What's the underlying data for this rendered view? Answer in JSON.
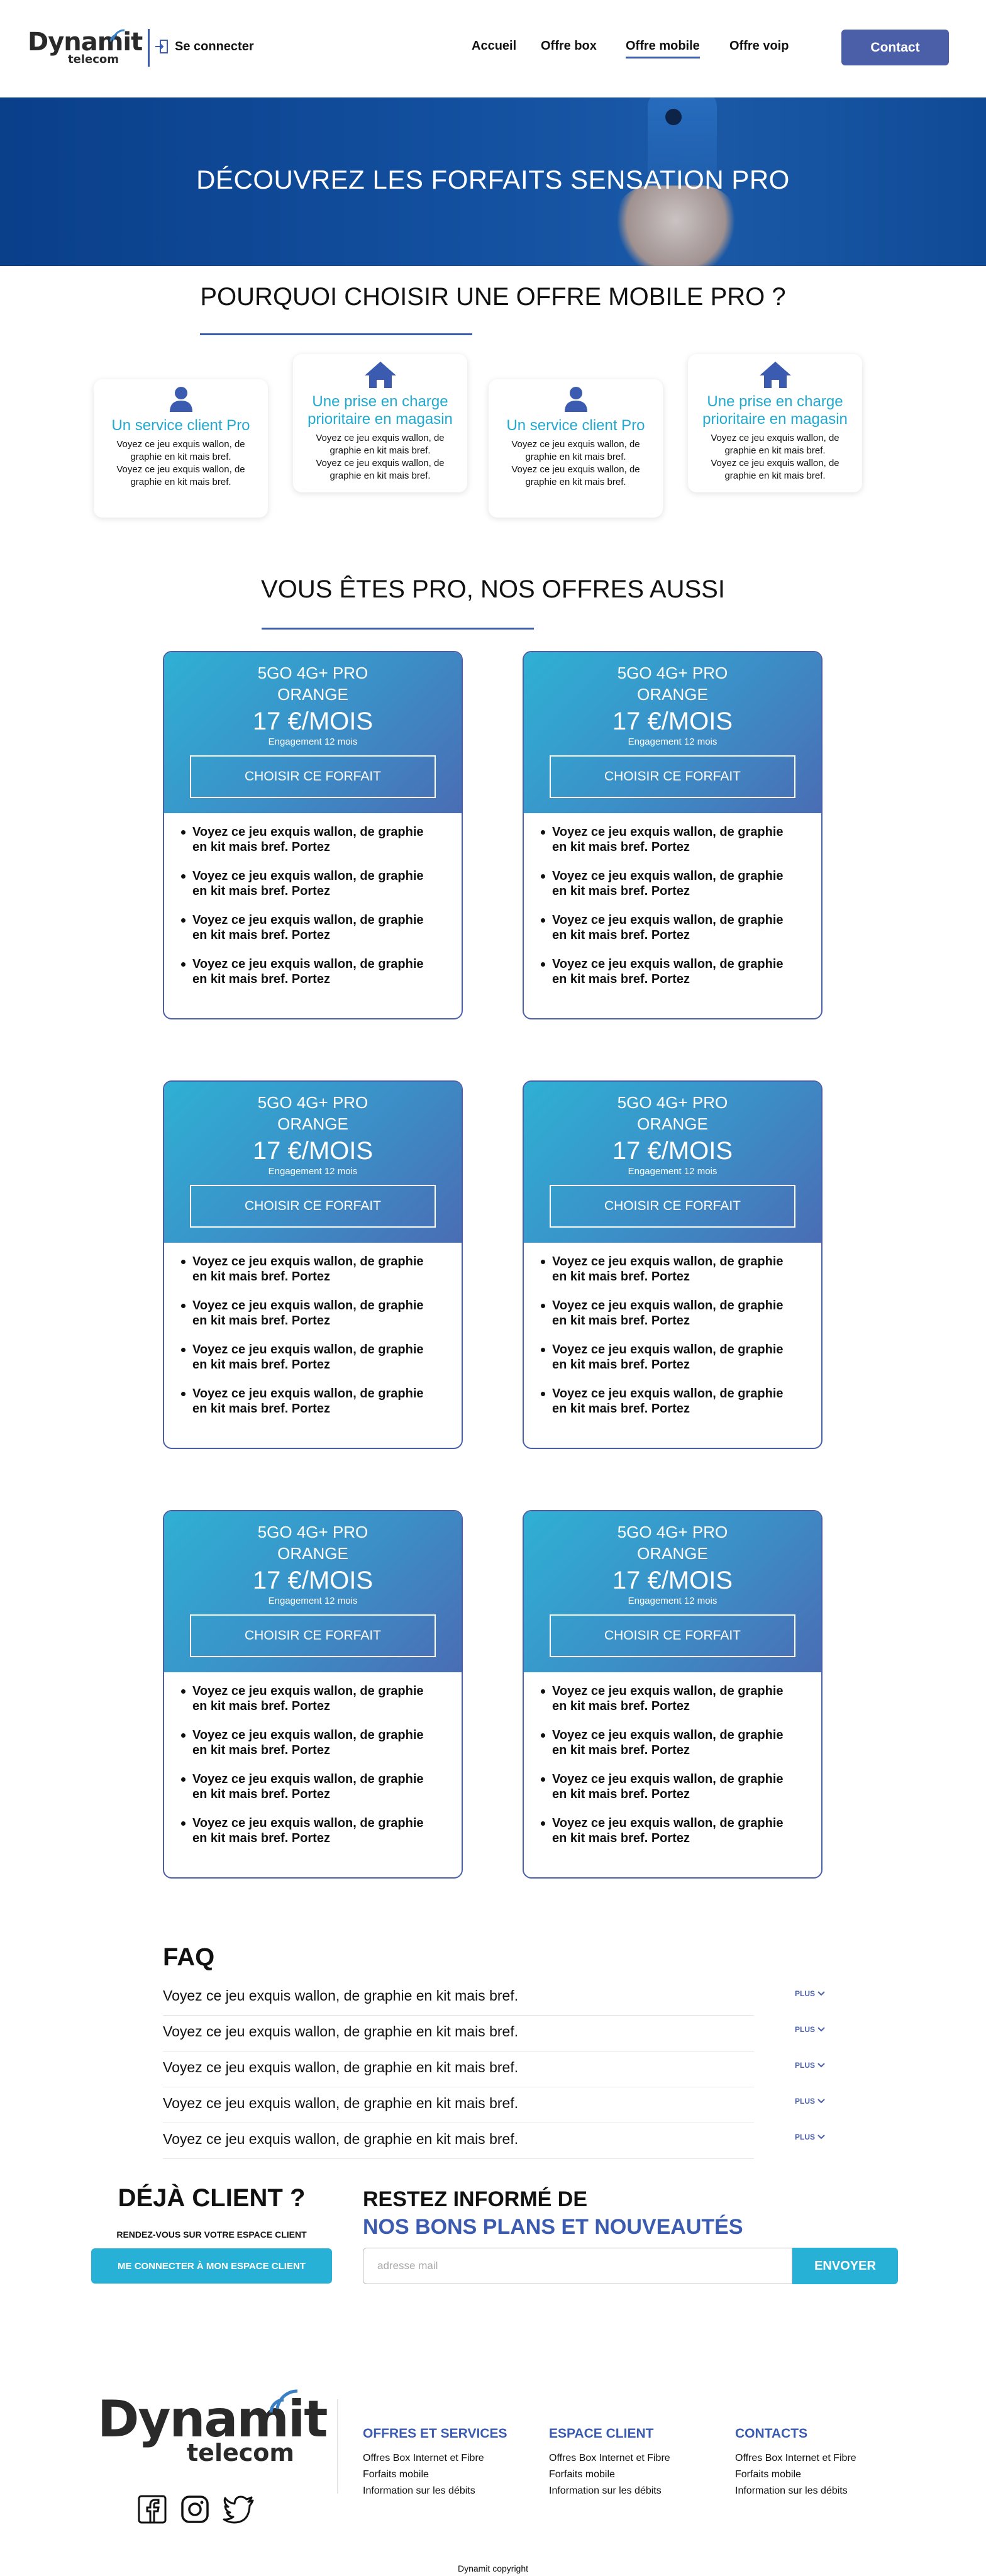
{
  "header": {
    "logo_text": "Dynamit",
    "logo_sub": "telecom",
    "login_label": "Se connecter",
    "nav": [
      {
        "label": "Accueil",
        "active": false
      },
      {
        "label": "Offre box",
        "active": false
      },
      {
        "label": "Offre mobile",
        "active": true
      },
      {
        "label": "Offre voip",
        "active": false
      }
    ],
    "contact_label": "Contact"
  },
  "hero": {
    "title": "DÉCOUVREZ LES FORFAITS SENSATION PRO"
  },
  "why": {
    "title": "POURQUOI CHOISIR UNE OFFRE MOBILE PRO ?",
    "features": [
      {
        "icon": "user-icon",
        "title": "Un service client Pro",
        "text1": "Voyez ce jeu exquis wallon, de graphie en kit mais bref.",
        "text2": "Voyez ce jeu exquis wallon, de graphie en kit mais bref."
      },
      {
        "icon": "home-icon",
        "title": "Une prise en charge prioritaire en magasin",
        "text1": "Voyez ce jeu exquis wallon, de graphie en kit mais bref.",
        "text2": "Voyez ce jeu exquis wallon, de graphie en kit mais bref."
      },
      {
        "icon": "user-icon",
        "title": "Un service client Pro",
        "text1": "Voyez ce jeu exquis wallon, de graphie en kit mais bref.",
        "text2": "Voyez ce jeu exquis wallon, de graphie en kit mais bref."
      },
      {
        "icon": "home-icon",
        "title": "Une prise en charge prioritaire en magasin",
        "text1": "Voyez ce jeu exquis wallon, de graphie en kit mais bref.",
        "text2": "Voyez ce jeu exquis wallon, de graphie en kit mais bref."
      }
    ]
  },
  "offers": {
    "title": "VOUS ÊTES PRO, NOS OFFRES AUSSI",
    "cards": [
      {
        "name1": "5GO 4G+ PRO",
        "name2": "ORANGE",
        "price": "17 €/MOIS",
        "engagement": "Engagement 12 mois",
        "button": "CHOISIR CE FORFAIT",
        "features": [
          "Voyez ce jeu exquis wallon, de graphie en kit mais bref. Portez",
          "Voyez ce jeu exquis wallon, de graphie en kit mais bref. Portez",
          "Voyez ce jeu exquis wallon, de graphie en kit mais bref. Portez",
          "Voyez ce jeu exquis wallon, de graphie en kit mais bref. Portez"
        ]
      },
      {
        "name1": "5GO 4G+ PRO",
        "name2": "ORANGE",
        "price": "17 €/MOIS",
        "engagement": "Engagement 12 mois",
        "button": "CHOISIR CE FORFAIT",
        "features": [
          "Voyez ce jeu exquis wallon, de graphie en kit mais bref. Portez",
          "Voyez ce jeu exquis wallon, de graphie en kit mais bref. Portez",
          "Voyez ce jeu exquis wallon, de graphie en kit mais bref. Portez",
          "Voyez ce jeu exquis wallon, de graphie en kit mais bref. Portez"
        ]
      },
      {
        "name1": "5GO 4G+ PRO",
        "name2": "ORANGE",
        "price": "17 €/MOIS",
        "engagement": "Engagement 12 mois",
        "button": "CHOISIR CE FORFAIT",
        "features": [
          "Voyez ce jeu exquis wallon, de graphie en kit mais bref. Portez",
          "Voyez ce jeu exquis wallon, de graphie en kit mais bref. Portez",
          "Voyez ce jeu exquis wallon, de graphie en kit mais bref. Portez",
          "Voyez ce jeu exquis wallon, de graphie en kit mais bref. Portez"
        ]
      },
      {
        "name1": "5GO 4G+ PRO",
        "name2": "ORANGE",
        "price": "17 €/MOIS",
        "engagement": "Engagement 12 mois",
        "button": "CHOISIR CE FORFAIT",
        "features": [
          "Voyez ce jeu exquis wallon, de graphie en kit mais bref. Portez",
          "Voyez ce jeu exquis wallon, de graphie en kit mais bref. Portez",
          "Voyez ce jeu exquis wallon, de graphie en kit mais bref. Portez",
          "Voyez ce jeu exquis wallon, de graphie en kit mais bref. Portez"
        ]
      },
      {
        "name1": "5GO 4G+ PRO",
        "name2": "ORANGE",
        "price": "17 €/MOIS",
        "engagement": "Engagement 12 mois",
        "button": "CHOISIR CE FORFAIT",
        "features": [
          "Voyez ce jeu exquis wallon, de graphie en kit mais bref. Portez",
          "Voyez ce jeu exquis wallon, de graphie en kit mais bref. Portez",
          "Voyez ce jeu exquis wallon, de graphie en kit mais bref. Portez",
          "Voyez ce jeu exquis wallon, de graphie en kit mais bref. Portez"
        ]
      },
      {
        "name1": "5GO 4G+ PRO",
        "name2": "ORANGE",
        "price": "17 €/MOIS",
        "engagement": "Engagement 12 mois",
        "button": "CHOISIR CE FORFAIT",
        "features": [
          "Voyez ce jeu exquis wallon, de graphie en kit mais bref. Portez",
          "Voyez ce jeu exquis wallon, de graphie en kit mais bref. Portez",
          "Voyez ce jeu exquis wallon, de graphie en kit mais bref. Portez",
          "Voyez ce jeu exquis wallon, de graphie en kit mais bref. Portez"
        ]
      }
    ]
  },
  "faq": {
    "title": "FAQ",
    "more_label": "PLUS",
    "items": [
      "Voyez ce jeu exquis wallon, de graphie en kit mais bref.",
      "Voyez ce jeu exquis wallon, de graphie en kit mais bref.",
      "Voyez ce jeu exquis wallon, de graphie en kit mais bref.",
      "Voyez ce jeu exquis wallon, de graphie en kit mais bref.",
      "Voyez ce jeu exquis wallon, de graphie en kit mais bref."
    ]
  },
  "client": {
    "title": "DÉJÀ CLIENT ?",
    "subtitle": "RENDEZ-VOUS SUR VOTRE ESPACE CLIENT",
    "button": "ME CONNECTER À MON ESPACE CLIENT"
  },
  "newsletter": {
    "title": "RESTEZ INFORMÉ DE",
    "subtitle": "NOS BONS PLANS ET NOUVEAUTÉS",
    "placeholder": "adresse mail",
    "button": "ENVOYER"
  },
  "footer": {
    "logo_text": "Dynamit",
    "logo_sub": "telecom",
    "social": [
      "facebook-icon",
      "instagram-icon",
      "twitter-icon"
    ],
    "columns": [
      {
        "title": "OFFRES ET SERVICES",
        "links": [
          "Offres Box Internet et Fibre",
          "Forfaits mobile",
          "Information sur les débits"
        ]
      },
      {
        "title": "ESPACE CLIENT",
        "links": [
          "Offres Box Internet et Fibre",
          "Forfaits mobile",
          "Information sur les débits"
        ]
      },
      {
        "title": "CONTACTS",
        "links": [
          "Offres Box Internet et Fibre",
          "Forfaits mobile",
          "Information sur les débits"
        ]
      }
    ],
    "copyright": "Dynamit copyright"
  },
  "colors": {
    "accent_blue": "#3b5bb0",
    "button_blue": "#4a5fa8",
    "cyan": "#28b1d6",
    "hero_bg": "#124f9e"
  }
}
